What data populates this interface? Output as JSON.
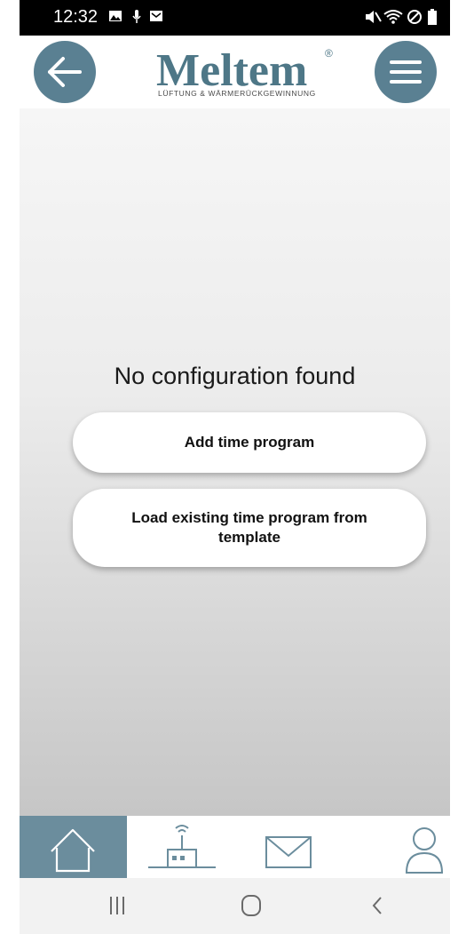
{
  "status_bar": {
    "time": "12:32"
  },
  "header": {
    "logo_text": "Meltem",
    "logo_subtitle": "LÜFTUNG & WÄRMERÜCKGEWINNUNG",
    "registered_mark": "®"
  },
  "main": {
    "empty_message": "No configuration found",
    "add_button_label": "Add time program",
    "load_button_label": "Load existing time program from template"
  },
  "tabs": [
    {
      "icon": "home-icon",
      "active": true
    },
    {
      "icon": "router-icon",
      "active": false
    },
    {
      "icon": "mail-icon",
      "active": false
    },
    {
      "icon": "user-icon",
      "active": false
    }
  ],
  "colors": {
    "accent": "#5a8092",
    "active_tab": "#6b8d9d",
    "logo": "#4e7787"
  }
}
